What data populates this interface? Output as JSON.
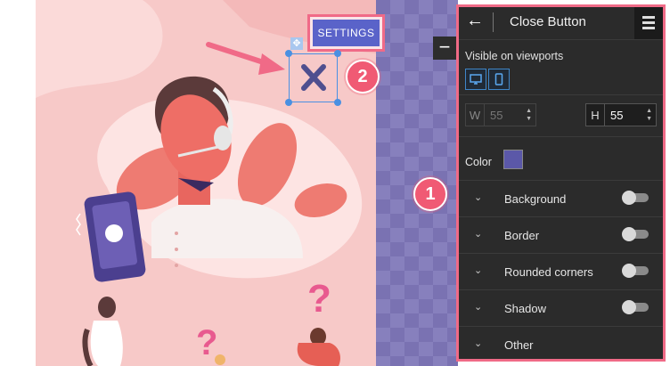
{
  "canvas": {
    "settings_button": "SETTINGS",
    "minus_label": "−",
    "colors": {
      "illustration_bg": "#f7c9c8",
      "accent": "#f06a87",
      "close_x": "#4f4f8f",
      "settings": "#5a63c9"
    }
  },
  "annotations": {
    "badge_1": "1",
    "badge_2": "2"
  },
  "panel": {
    "title": "Close Button",
    "visible_label": "Visible on viewports",
    "viewports": [
      "desktop-icon",
      "mobile-icon"
    ],
    "width": {
      "label": "W",
      "value": "55"
    },
    "height": {
      "label": "H",
      "value": "55"
    },
    "color_label": "Color",
    "color_value": "#5b58a8",
    "sections": [
      {
        "label": "Background"
      },
      {
        "label": "Border"
      },
      {
        "label": "Rounded corners"
      },
      {
        "label": "Shadow"
      },
      {
        "label": "Other"
      }
    ]
  }
}
